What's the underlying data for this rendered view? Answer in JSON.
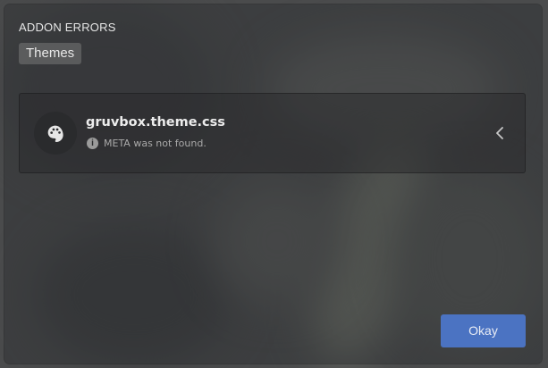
{
  "dialog": {
    "title": "ADDON ERRORS",
    "tabs": [
      {
        "label": "Themes",
        "selected": true
      }
    ],
    "errors": [
      {
        "addon_name": "gruvbox.theme.css",
        "message": "META was not found.",
        "icon": "palette-icon",
        "status_icon": "info-icon",
        "expand_icon": "chevron-left-icon"
      }
    ],
    "ok_label": "Okay"
  },
  "colors": {
    "accent": "#4b73c2",
    "card_background": "#2a2b2d",
    "text_primary": "#ececec",
    "text_secondary": "#a9a9a9"
  }
}
